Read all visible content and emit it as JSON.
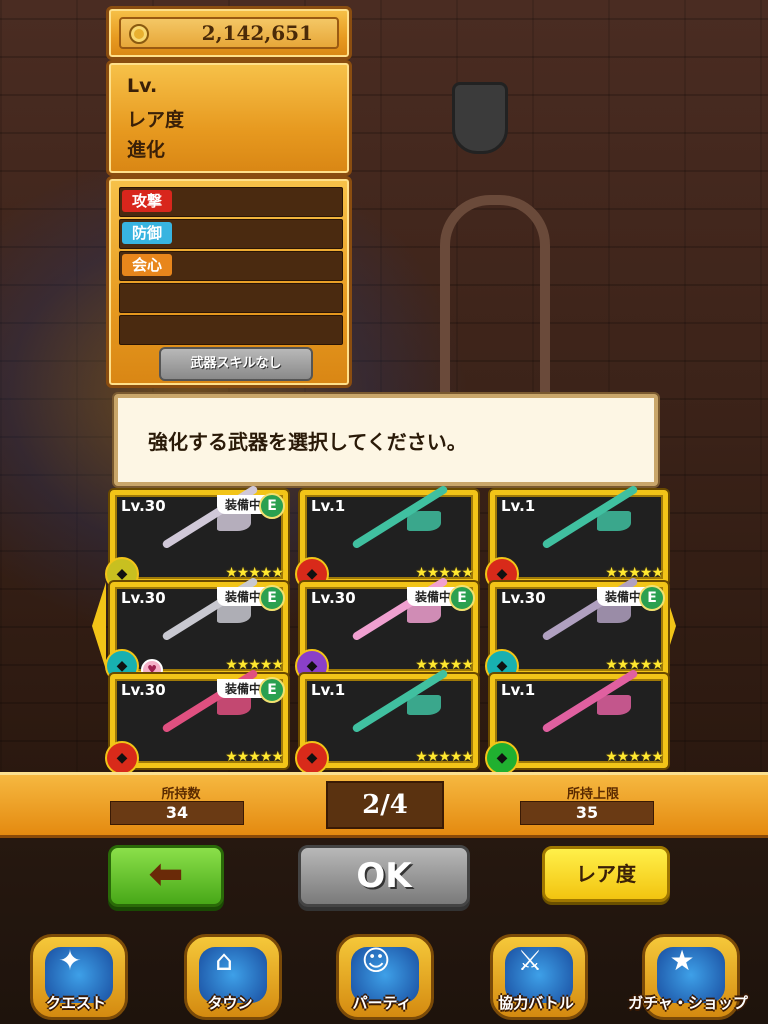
{
  "currency": {
    "value": "2,142,651",
    "icon": "coin-icon"
  },
  "info": {
    "level_label": "Lv.",
    "rarity_label": "レア度",
    "evolution_label": "進化"
  },
  "stats": {
    "attack_label": "攻撃",
    "defense_label": "防御",
    "critical_label": "会心",
    "skill_button": "武器スキルなし",
    "colors": {
      "attack": "#d8261c",
      "defense": "#38b4e0",
      "critical": "#e8861c"
    }
  },
  "message": "強化する武器を選択してください。",
  "weapons": [
    {
      "level": "Lv.30",
      "equipped": "装備中",
      "badge": "E",
      "stars": "★★★★★",
      "element_icon": "earth-icon",
      "element_color": "#c8c020",
      "weapon_color": "#d0c8d8"
    },
    {
      "level": "Lv.1",
      "equipped": "",
      "badge": "",
      "stars": "★★★★★",
      "element_icon": "fire-icon",
      "element_color": "#d82a1a",
      "weapon_color": "#40c0a0"
    },
    {
      "level": "Lv.1",
      "equipped": "",
      "badge": "",
      "stars": "★★★★★",
      "element_icon": "fire-icon",
      "element_color": "#d82a1a",
      "weapon_color": "#40c0a0"
    },
    {
      "level": "Lv.30",
      "equipped": "装備中",
      "badge": "E",
      "stars": "★★★★★",
      "element_icon": "wind-icon",
      "element_color": "#18b0b0",
      "weapon_color": "#c8c8d0"
    },
    {
      "level": "Lv.30",
      "equipped": "装備中",
      "badge": "E",
      "stars": "★★★★★",
      "element_icon": "dark-icon",
      "element_color": "#8a40c8",
      "weapon_color": "#f0a0d0"
    },
    {
      "level": "Lv.30",
      "equipped": "装備中",
      "badge": "E",
      "stars": "★★★★★",
      "element_icon": "wind-icon",
      "element_color": "#18b0b0",
      "weapon_color": "#b0a0c0"
    },
    {
      "level": "Lv.30",
      "equipped": "装備中",
      "badge": "E",
      "stars": "★★★★★",
      "element_icon": "fire-icon",
      "element_color": "#d82a1a",
      "weapon_color": "#e05080"
    },
    {
      "level": "Lv.1",
      "equipped": "",
      "badge": "",
      "stars": "★★★★★",
      "element_icon": "fire-icon",
      "element_color": "#d82a1a",
      "weapon_color": "#40c0a0"
    },
    {
      "level": "Lv.1",
      "equipped": "",
      "badge": "",
      "stars": "★★★★★",
      "element_icon": "nature-icon",
      "element_color": "#20b030",
      "weapon_color": "#e060a0"
    }
  ],
  "inventory": {
    "owned_label": "所持数",
    "owned_value": "34",
    "page": "2/4",
    "limit_label": "所持上限",
    "limit_value": "35"
  },
  "buttons": {
    "ok": "OK",
    "rarity": "レア度"
  },
  "nav": [
    {
      "label": "クエスト",
      "icon": "quest-icon",
      "glyph": "✦"
    },
    {
      "label": "タウン",
      "icon": "town-icon",
      "glyph": "⌂"
    },
    {
      "label": "パーティ",
      "icon": "party-icon",
      "glyph": "☺"
    },
    {
      "label": "協力バトル",
      "icon": "coop-battle-icon",
      "glyph": "⚔"
    },
    {
      "label": "ガチャ・ショップ",
      "icon": "gacha-shop-icon",
      "glyph": "★"
    }
  ]
}
